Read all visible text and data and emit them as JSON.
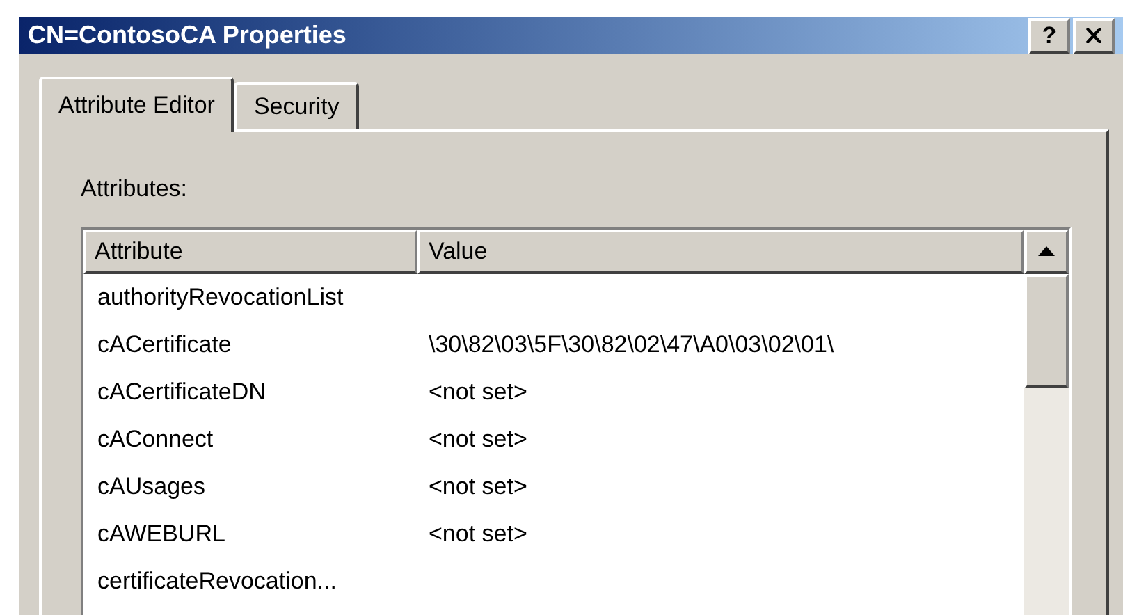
{
  "window": {
    "title": "CN=ContosoCA Properties",
    "help_button": "?"
  },
  "tabs": [
    {
      "label": "Attribute Editor",
      "selected": true
    },
    {
      "label": "Security",
      "selected": false
    }
  ],
  "attributes_label": "Attributes:",
  "table": {
    "columns": [
      "Attribute",
      "Value"
    ],
    "rows": [
      {
        "attribute": "authorityRevocationList"
      },
      {
        "attribute": "cACertificate",
        "value": "\\30\\82\\03\\5F\\30\\82\\02\\47\\A0\\03\\02\\01\\"
      },
      {
        "attribute": "cACertificateDN",
        "value": "<not set>"
      },
      {
        "attribute": "cAConnect",
        "value": "<not set>"
      },
      {
        "attribute": "cAUsages",
        "value": "<not set>"
      },
      {
        "attribute": "cAWEBURL",
        "value": "<not set>"
      },
      {
        "attribute": "certificateRevocation..."
      }
    ]
  }
}
